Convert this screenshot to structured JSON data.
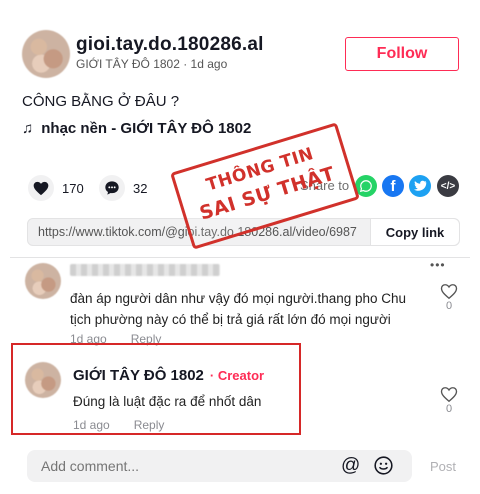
{
  "post": {
    "username": "gioi.tay.do.180286.al",
    "subline": "GIỚI TÂY ĐÔ 1802 · 1d ago",
    "follow_label": "Follow",
    "caption": "CÔNG BẰNG Ở ĐÂU ?",
    "music_label": "nhạc nền - GIỚI TÂY ĐÔ 1802",
    "likes": "170",
    "comments": "32",
    "share_label": "Share to",
    "link": "https://www.tiktok.com/@gioi.tay.do.180286.al/video/6987...",
    "copy_label": "Copy link"
  },
  "stamp": {
    "line1": "THÔNG TIN",
    "line2": "SAI SỰ THẬT"
  },
  "comment1": {
    "text": "đàn áp người dân như vậy đó mọi người.thang pho Chu tịch phường này có thể bị trả giá rất lớn đó mọi người",
    "time": "1d ago",
    "reply": "Reply",
    "likes": "0"
  },
  "comment2": {
    "name": "GIỚI TÂY ĐÔ 1802",
    "creator_label": "· Creator",
    "text": "Đúng là luật đặc ra để nhốt dân",
    "time": "1d ago",
    "reply": "Reply",
    "likes": "0"
  },
  "comment_bar": {
    "placeholder": "Add comment...",
    "post_label": "Post"
  },
  "colors": {
    "accent": "#fe2c55",
    "stamp_red": "#d1312b",
    "highlight_red": "#d62828"
  }
}
